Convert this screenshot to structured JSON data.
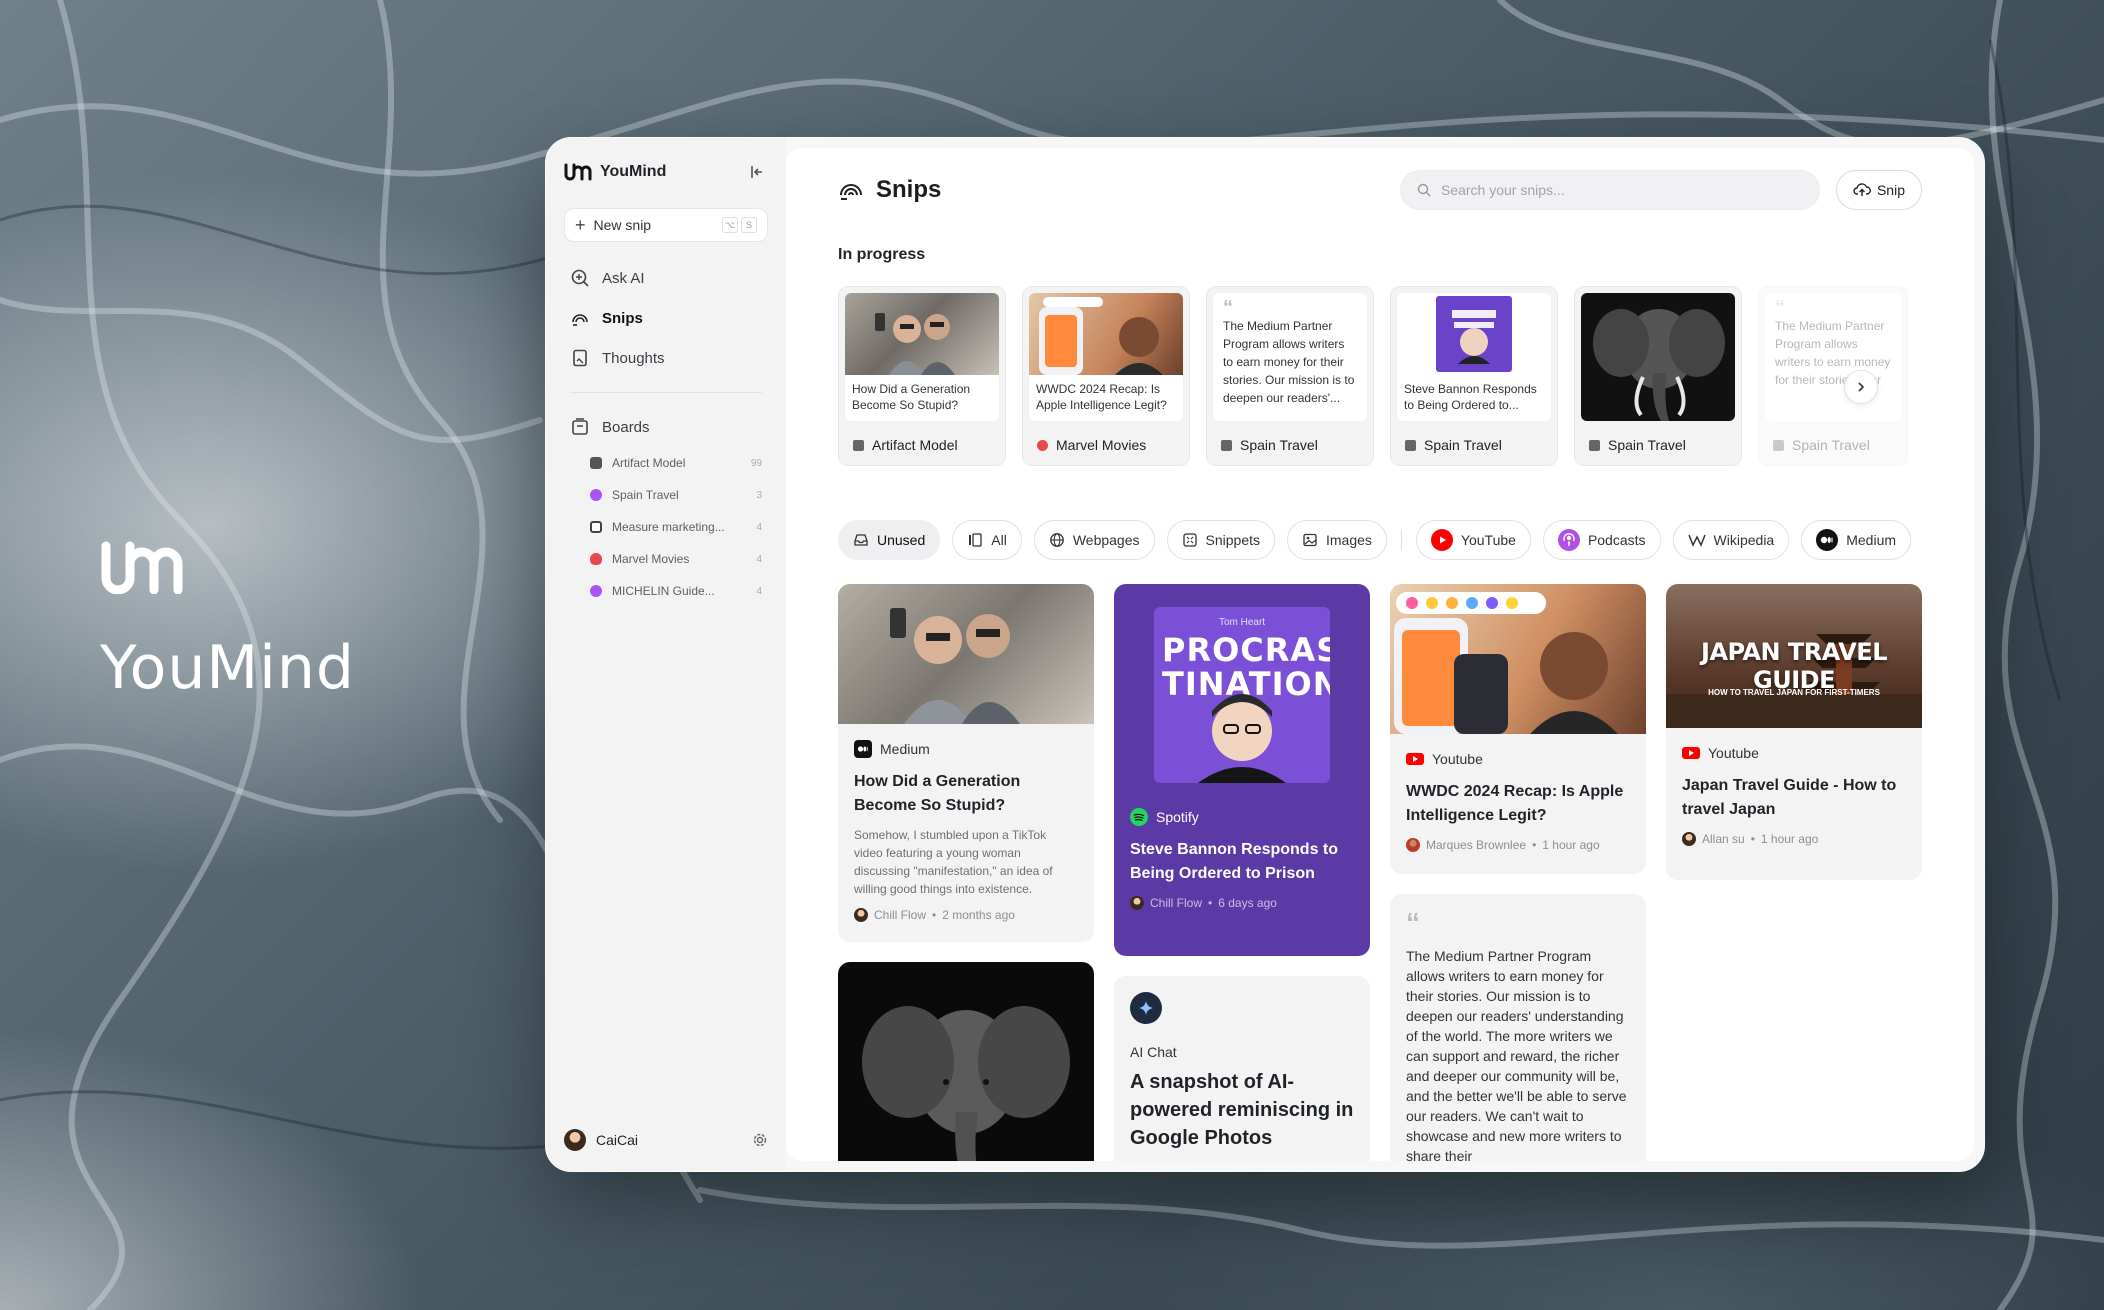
{
  "brand": {
    "name": "YouMind"
  },
  "sidebar": {
    "app_name": "YouMind",
    "new_snip": {
      "label": "New snip",
      "keys": [
        "⌥",
        "S"
      ]
    },
    "nav": [
      {
        "label": "Ask AI",
        "icon": "ask-ai-icon"
      },
      {
        "label": "Snips",
        "icon": "snips-icon",
        "active": true
      },
      {
        "label": "Thoughts",
        "icon": "thoughts-icon"
      }
    ],
    "boards_label": "Boards",
    "boards": [
      {
        "name": "Artifact Model",
        "count": "99",
        "color": "#555555"
      },
      {
        "name": "Spain Travel",
        "count": "3",
        "color": "#a855f7"
      },
      {
        "name": "Measure marketing...",
        "count": "4",
        "color": "#444444"
      },
      {
        "name": "Marvel Movies",
        "count": "4",
        "color": "#e5484d"
      },
      {
        "name": "MICHELIN Guide...",
        "count": "4",
        "color": "#a855f7"
      }
    ],
    "user": {
      "name": "CaiCai"
    }
  },
  "header": {
    "title": "Snips",
    "search_placeholder": "Search your snips...",
    "snip_button": "Snip"
  },
  "in_progress": {
    "title": "In progress",
    "items": [
      {
        "kind": "image",
        "text": "How Did a Generation Become So Stupid?",
        "board": "Artifact Model"
      },
      {
        "kind": "image",
        "text": "WWDC 2024 Recap: Is Apple Intelligence Legit?",
        "board": "Marvel Movies"
      },
      {
        "kind": "quote",
        "text": "The Medium Partner Program allows writers to earn money for their stories. Our mission is to deepen our readers'...",
        "board": "Spain Travel"
      },
      {
        "kind": "image",
        "text": "Steve Bannon Responds to Being Ordered to...",
        "board": "Spain Travel"
      },
      {
        "kind": "photo",
        "text": "",
        "board": "Spain Travel"
      },
      {
        "kind": "quote",
        "text": "The Medium Partner Program allows writers to earn money for their stories. Our mission is to deepen our readers'...",
        "board": "Spain Travel"
      }
    ]
  },
  "filters": [
    {
      "label": "Unused",
      "active": true,
      "icon": "inbox-icon"
    },
    {
      "label": "All",
      "icon": "all-icon"
    },
    {
      "label": "Webpages",
      "icon": "globe-icon"
    },
    {
      "label": "Snippets",
      "icon": "snippet-icon"
    },
    {
      "label": "Images",
      "icon": "image-icon"
    },
    {
      "label": "YouTube",
      "icon": "youtube-icon"
    },
    {
      "label": "Podcasts",
      "icon": "podcast-icon"
    },
    {
      "label": "Wikipedia",
      "icon": "wikipedia-icon"
    },
    {
      "label": "Medium",
      "icon": "medium-icon"
    }
  ],
  "cards": {
    "medium": {
      "source": "Medium",
      "title": "How Did a Generation Become So Stupid?",
      "desc": "Somehow, I stumbled upon a TikTok video featuring a young woman discussing \"manifestation,\" an idea of willing good things into existence.",
      "author": "Chill Flow",
      "time": "2 months ago"
    },
    "spotify": {
      "source": "Spotify",
      "cover_author": "Tom Heart",
      "cover_title": "PROCRAS TINATION",
      "title": "Steve Bannon Responds to Being Ordered to Prison",
      "author": "Chill Flow",
      "time": "6 days ago"
    },
    "wwdc": {
      "source": "Youtube",
      "title": "WWDC 2024 Recap: Is Apple Intelligence Legit?",
      "author": "Marques Brownlee",
      "time": "1 hour ago"
    },
    "japan": {
      "source": "Youtube",
      "banner": "JAPAN TRAVEL GUIDE",
      "banner_sub": "HOW TO TRAVEL JAPAN FOR FIRST-TIMERS",
      "title": "Japan Travel Guide - How to travel Japan",
      "author": "Allan su",
      "time": "1 hour ago"
    },
    "chat": {
      "source": "AI Chat",
      "title": "A snapshot of AI-powered reminiscing in Google Photos"
    },
    "quote": {
      "text": "The Medium Partner Program allows writers to earn money for their stories. Our mission is to deepen our readers' understanding of the world. The more writers we can support and reward, the richer and deeper our community will be, and the better we'll be able to serve our readers. We can't wait to showcase and new more writers to share their"
    }
  },
  "colors": {
    "accent_purple": "#5b3aa6",
    "youtube_red": "#ff0000",
    "spotify_green": "#1ed760"
  }
}
